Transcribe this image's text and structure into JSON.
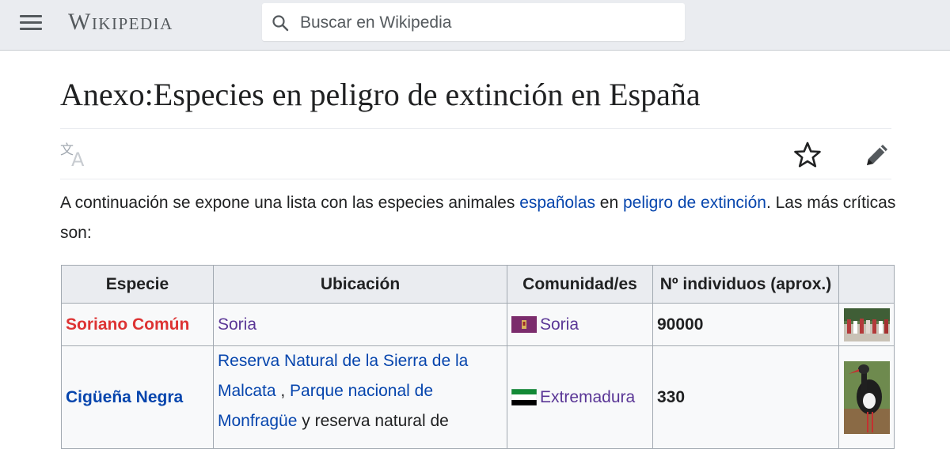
{
  "header": {
    "logo_text": "Wikipedia",
    "search_placeholder": "Buscar en Wikipedia"
  },
  "page": {
    "title": "Anexo:Especies en peligro de extinción en España"
  },
  "intro": {
    "text_1": "A continuación se expone una lista con las especies animales ",
    "link_1": "españolas",
    "text_2": " en ",
    "link_2": "peligro de extinción",
    "text_3": ". Las más críticas son:"
  },
  "table": {
    "headers": [
      "Especie",
      "Ubicación",
      "Comunidad/es",
      "Nº individuos (aprox.)"
    ],
    "rows": [
      {
        "especie": "Soriano Común",
        "ubicacion": "Soria",
        "comunidad": "Soria",
        "individuos": "90000"
      },
      {
        "especie": "Cigüeña Negra",
        "ubicacion_link_1": "Reserva Natural de la Sierra de la Malcata",
        "ubicacion_sep_1": " , ",
        "ubicacion_link_2": "Parque nacional de Monfragüe",
        "ubicacion_text": " y reserva natural de",
        "comunidad": "Extremadura",
        "individuos": "330"
      }
    ]
  },
  "colors": {
    "header_bg": "#eaecf0",
    "link": "#0645ad",
    "visited": "#5a3696",
    "redlink": "#d33"
  }
}
